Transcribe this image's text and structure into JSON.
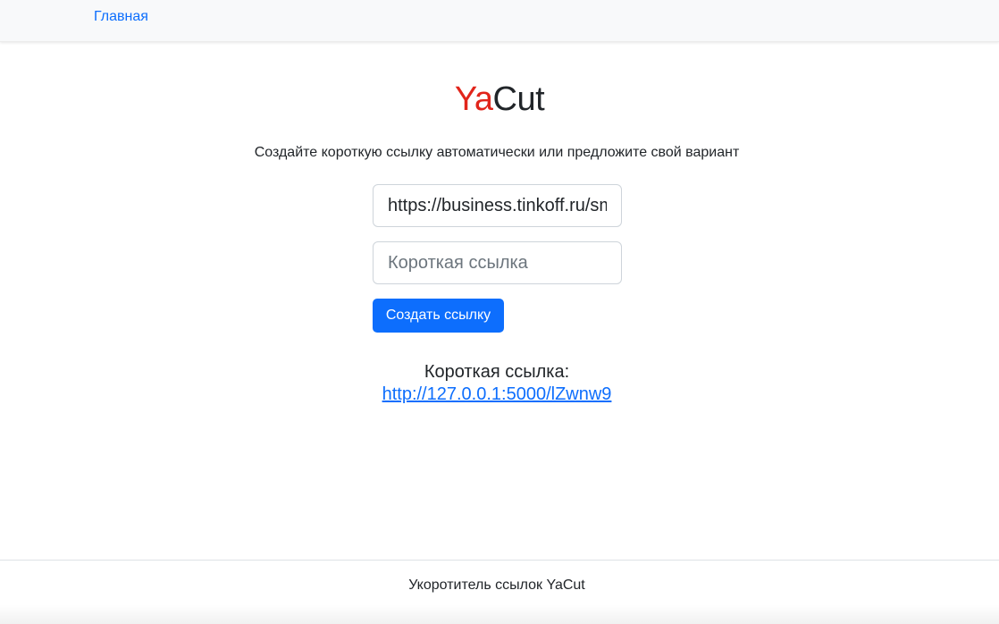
{
  "nav": {
    "home_label": "Главная"
  },
  "logo": {
    "part1": "Ya",
    "part2": "Cut"
  },
  "tagline": "Создайте короткую ссылку автоматически или предложите свой вариант",
  "form": {
    "original_url_value": "https://business.tinkoff.ru/sm",
    "custom_id_value": "",
    "custom_id_placeholder": "Короткая ссылка",
    "submit_label": "Создать ссылку"
  },
  "result": {
    "label": "Короткая ссылка:",
    "link": "http://127.0.0.1:5000/lZwnw9"
  },
  "footer": {
    "text": "Укоротитель ссылок YaCut"
  },
  "colors": {
    "accent": "#0d6efd",
    "logo_red": "#e1251b",
    "navbar_bg": "#f8f9fa"
  }
}
